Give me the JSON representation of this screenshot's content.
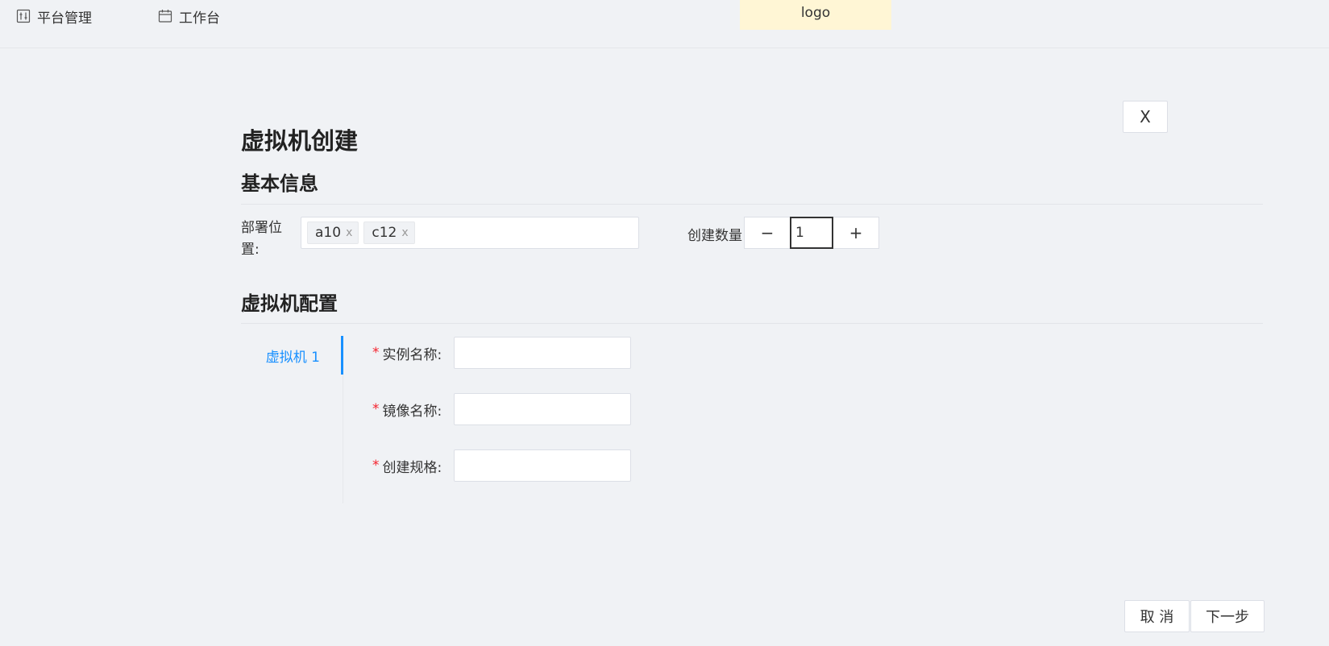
{
  "topbar": {
    "nav": [
      {
        "label": "平台管理",
        "icon": "sliders-icon"
      },
      {
        "label": "工作台",
        "icon": "calendar-icon"
      }
    ],
    "logo_text": "logo"
  },
  "dialog": {
    "close_label": "X",
    "title": "虚拟机创建",
    "basic_section": "基本信息",
    "deploy_label": "部署位置:",
    "deploy_tags": [
      "a10",
      "c12"
    ],
    "tag_remove": "x",
    "count_label": "创建数量",
    "count_minus": "−",
    "count_value": "1",
    "count_plus": "+",
    "config_section": "虚拟机配置",
    "vm_tab": "虚拟机 1",
    "required_mark": "*",
    "fields": [
      {
        "label": "实例名称:",
        "value": ""
      },
      {
        "label": "镜像名称:",
        "value": ""
      },
      {
        "label": "创建规格:",
        "value": ""
      }
    ],
    "cancel_label": "取 消",
    "next_label": "下一步"
  },
  "colors": {
    "background": "#f0f2f5",
    "accent": "#1890ff",
    "required": "#f5222d",
    "logo_bg": "#fff6d5"
  }
}
